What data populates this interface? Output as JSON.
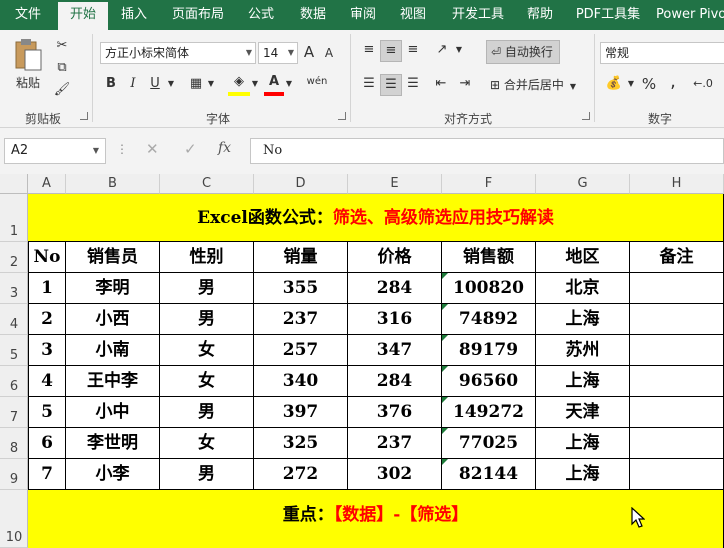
{
  "tabs": [
    "文件",
    "开始",
    "插入",
    "页面布局",
    "公式",
    "数据",
    "审阅",
    "视图",
    "开发工具",
    "帮助",
    "PDF工具集",
    "Power Pivot"
  ],
  "ribbon": {
    "clipboard": {
      "paste_label": "粘贴",
      "group_label": "剪贴板"
    },
    "font": {
      "font_name": "方正小标宋简体",
      "font_size": "14",
      "bold": "B",
      "italic": "I",
      "underline": "U",
      "grow": "A",
      "shrink": "A",
      "wen": "wén",
      "group_label": "字体"
    },
    "alignment": {
      "wrap_label": "自动换行",
      "merge_label": "合并后居中",
      "group_label": "对齐方式"
    },
    "number": {
      "format": "常规",
      "percent": "%",
      "comma": ",",
      "group_label": "数字"
    }
  },
  "formula_bar": {
    "name_box": "A2",
    "fx": "fx",
    "content": "No"
  },
  "columns": [
    "A",
    "B",
    "C",
    "D",
    "E",
    "F",
    "G",
    "H"
  ],
  "rows": [
    "1",
    "2",
    "3",
    "4",
    "5",
    "6",
    "7",
    "8",
    "9",
    "10"
  ],
  "sheet": {
    "title_black": "Excel函数公式：",
    "title_red": "筛选、高级筛选应用技巧解读",
    "headers": [
      "No",
      "销售员",
      "性别",
      "销量",
      "价格",
      "销售额",
      "地区",
      "备注"
    ],
    "data": [
      [
        "1",
        "李明",
        "男",
        "355",
        "284",
        "100820",
        "北京",
        ""
      ],
      [
        "2",
        "小西",
        "男",
        "237",
        "316",
        "74892",
        "上海",
        ""
      ],
      [
        "3",
        "小南",
        "女",
        "257",
        "347",
        "89179",
        "苏州",
        ""
      ],
      [
        "4",
        "王中李",
        "女",
        "340",
        "284",
        "96560",
        "上海",
        ""
      ],
      [
        "5",
        "小中",
        "男",
        "397",
        "376",
        "149272",
        "天津",
        ""
      ],
      [
        "6",
        "李世明",
        "女",
        "325",
        "237",
        "77025",
        "上海",
        ""
      ],
      [
        "7",
        "小李",
        "男",
        "272",
        "302",
        "82144",
        "上海",
        ""
      ]
    ],
    "footer_black": "重点：",
    "footer_red": "【数据】-【筛选】"
  }
}
